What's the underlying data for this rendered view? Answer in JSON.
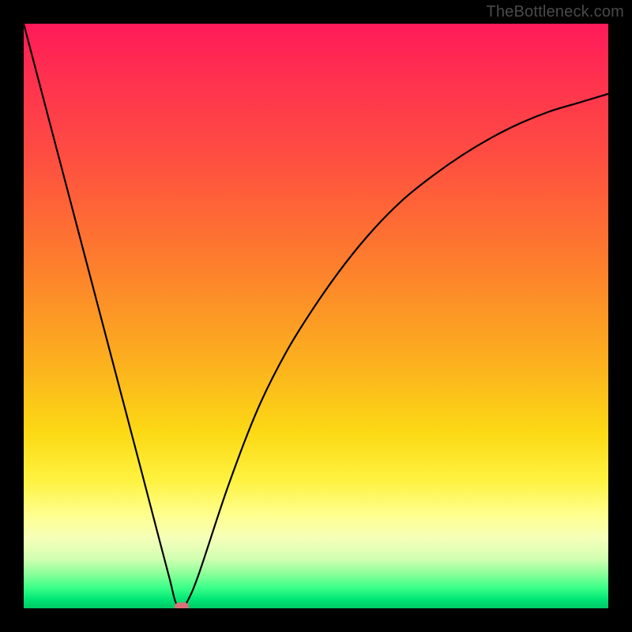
{
  "watermark": "TheBottleneck.com",
  "chart_data": {
    "type": "line",
    "title": "",
    "xlabel": "",
    "ylabel": "",
    "xlim": [
      0,
      100
    ],
    "ylim": [
      0,
      100
    ],
    "grid": false,
    "legend": false,
    "series": [
      {
        "name": "bottleneck-curve",
        "x": [
          0,
          5,
          10,
          15,
          20,
          23,
          25,
          26,
          27,
          28,
          30,
          35,
          40,
          45,
          50,
          55,
          60,
          65,
          70,
          75,
          80,
          85,
          90,
          95,
          100
        ],
        "y": [
          100,
          81,
          62,
          43,
          24,
          12.5,
          4.9,
          1.0,
          0.3,
          1.2,
          6,
          21,
          34,
          44,
          52,
          59,
          65,
          70,
          74,
          77.5,
          80.5,
          83,
          85,
          86.5,
          88
        ]
      }
    ],
    "marker": {
      "name": "minimum-point",
      "x": 27,
      "y": 0.3
    },
    "background_gradient": {
      "orientation": "vertical",
      "stops": [
        {
          "pos": 0.0,
          "color": "#ff1a5a"
        },
        {
          "pos": 0.22,
          "color": "#fe4c42"
        },
        {
          "pos": 0.58,
          "color": "#fcb01e"
        },
        {
          "pos": 0.84,
          "color": "#feff8e"
        },
        {
          "pos": 0.94,
          "color": "#8eff9a"
        },
        {
          "pos": 1.0,
          "color": "#00c864"
        }
      ]
    }
  }
}
